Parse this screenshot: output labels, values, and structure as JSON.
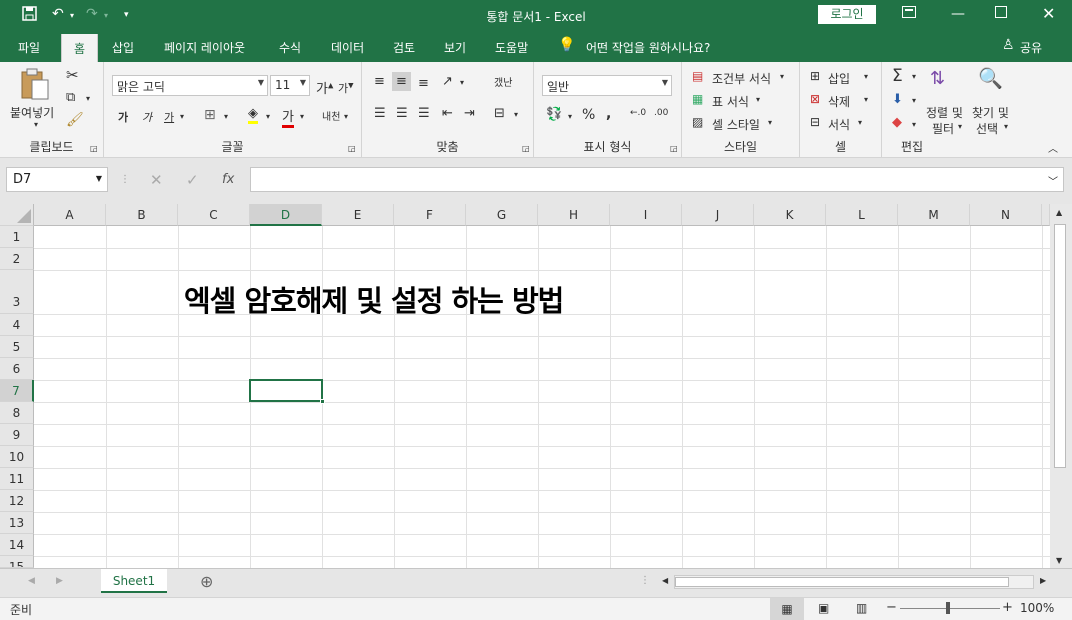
{
  "window": {
    "title": "통합 문서1  -  Excel",
    "login_label": "로그인",
    "save_icon": "save-icon",
    "undo_icon": "undo-icon",
    "redo_icon": "redo-icon"
  },
  "tabs": [
    {
      "label": "파일"
    },
    {
      "label": "홈"
    },
    {
      "label": "삽입"
    },
    {
      "label": "페이지 레이아웃"
    },
    {
      "label": "수식"
    },
    {
      "label": "데이터"
    },
    {
      "label": "검토"
    },
    {
      "label": "보기"
    },
    {
      "label": "도움말"
    }
  ],
  "tell_me": "어떤 작업을 원하시나요?",
  "share_label": "공유",
  "ribbon": {
    "clipboard": {
      "label": "클립보드",
      "paste": "붙여넣기"
    },
    "font": {
      "label": "글꼴",
      "font_name": "맑은 고딕",
      "font_size": "11",
      "bold": "가",
      "italic": "가",
      "underline": "가",
      "font_color_char": "가",
      "phonetic": "내천"
    },
    "alignment": {
      "label": "맞춤",
      "wrap": "갰난"
    },
    "number": {
      "label": "표시 형식",
      "format": "일반"
    },
    "styles": {
      "label": "스타일",
      "cond_format": "조건부 서식",
      "table_format": "표 서식",
      "cell_style": "셀 스타일"
    },
    "cells": {
      "label": "셀",
      "insert": "삽입",
      "delete": "삭제",
      "format": "서식"
    },
    "editing": {
      "label": "편집",
      "sort_filter_1": "정렬 및",
      "sort_filter_2": "필터",
      "find_select_1": "찾기 및",
      "find_select_2": "선택"
    }
  },
  "formula_bar": {
    "name_box": "D7",
    "formula": ""
  },
  "columns": [
    "A",
    "B",
    "C",
    "D",
    "E",
    "F",
    "G",
    "H",
    "I",
    "J",
    "K",
    "L",
    "M",
    "N"
  ],
  "selected_column": "D",
  "rows": [
    "1",
    "2",
    "3",
    "4",
    "5",
    "6",
    "7",
    "8",
    "9",
    "10",
    "11",
    "12",
    "13",
    "14",
    "15"
  ],
  "selected_row": "7",
  "cells": {
    "B3": "엑셀 암호해제 및 설정 하는 방법"
  },
  "sheets": [
    {
      "name": "Sheet1"
    }
  ],
  "status": {
    "ready": "준비",
    "zoom": "100%"
  }
}
